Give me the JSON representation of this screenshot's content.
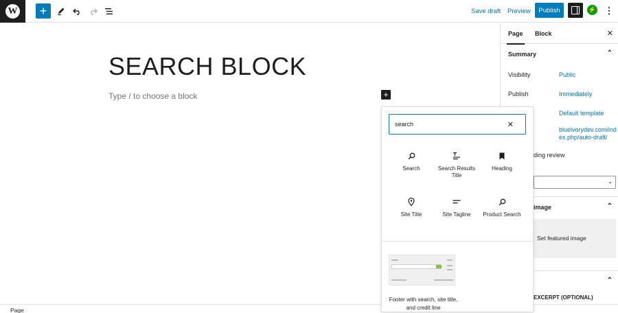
{
  "topbar": {
    "logo_letter": "W",
    "inserter_icon": "+",
    "tools_icon": "pencil-icon",
    "undo_icon": "undo-icon",
    "redo_icon": "redo-icon",
    "list_view_icon": "list-view-icon",
    "save_draft": "Save draft",
    "preview": "Preview",
    "publish": "Publish",
    "jetpack_icon": "jetpack-icon",
    "more_icon": "⋮"
  },
  "editor": {
    "title": "SEARCH BLOCK",
    "placeholder": "Type / to choose a block",
    "add_icon": "+"
  },
  "inserter": {
    "search_value": "search",
    "clear_icon": "✕",
    "blocks": [
      {
        "label": "Search",
        "icon": "search-icon"
      },
      {
        "label": "Search Results Title",
        "icon": "title-icon"
      },
      {
        "label": "Heading",
        "icon": "bookmark-icon"
      },
      {
        "label": "Site Title",
        "icon": "map-pin-icon"
      },
      {
        "label": "Site Tagline",
        "icon": "tagline-icon"
      },
      {
        "label": "Product Search",
        "icon": "search-icon"
      }
    ],
    "pattern_label": "Footer with search, site title, and credit line"
  },
  "sidebar": {
    "tab_page": "Page",
    "tab_block": "Block",
    "close_icon": "✕",
    "summary_title": "Summary",
    "visibility_label": "Visibility",
    "visibility_value": "Public",
    "publish_label": "Publish",
    "publish_value": "Immediately",
    "template_value": "Default template",
    "url_value": "bluelvorydev.com/index.php/auto-draft/",
    "pending_review": "ding review",
    "featured_image_title": "image",
    "set_featured_image": "Set featured image",
    "excerpt_title": "EXCERPT (OPTIONAL)"
  },
  "footer": {
    "breadcrumb": "Page"
  }
}
